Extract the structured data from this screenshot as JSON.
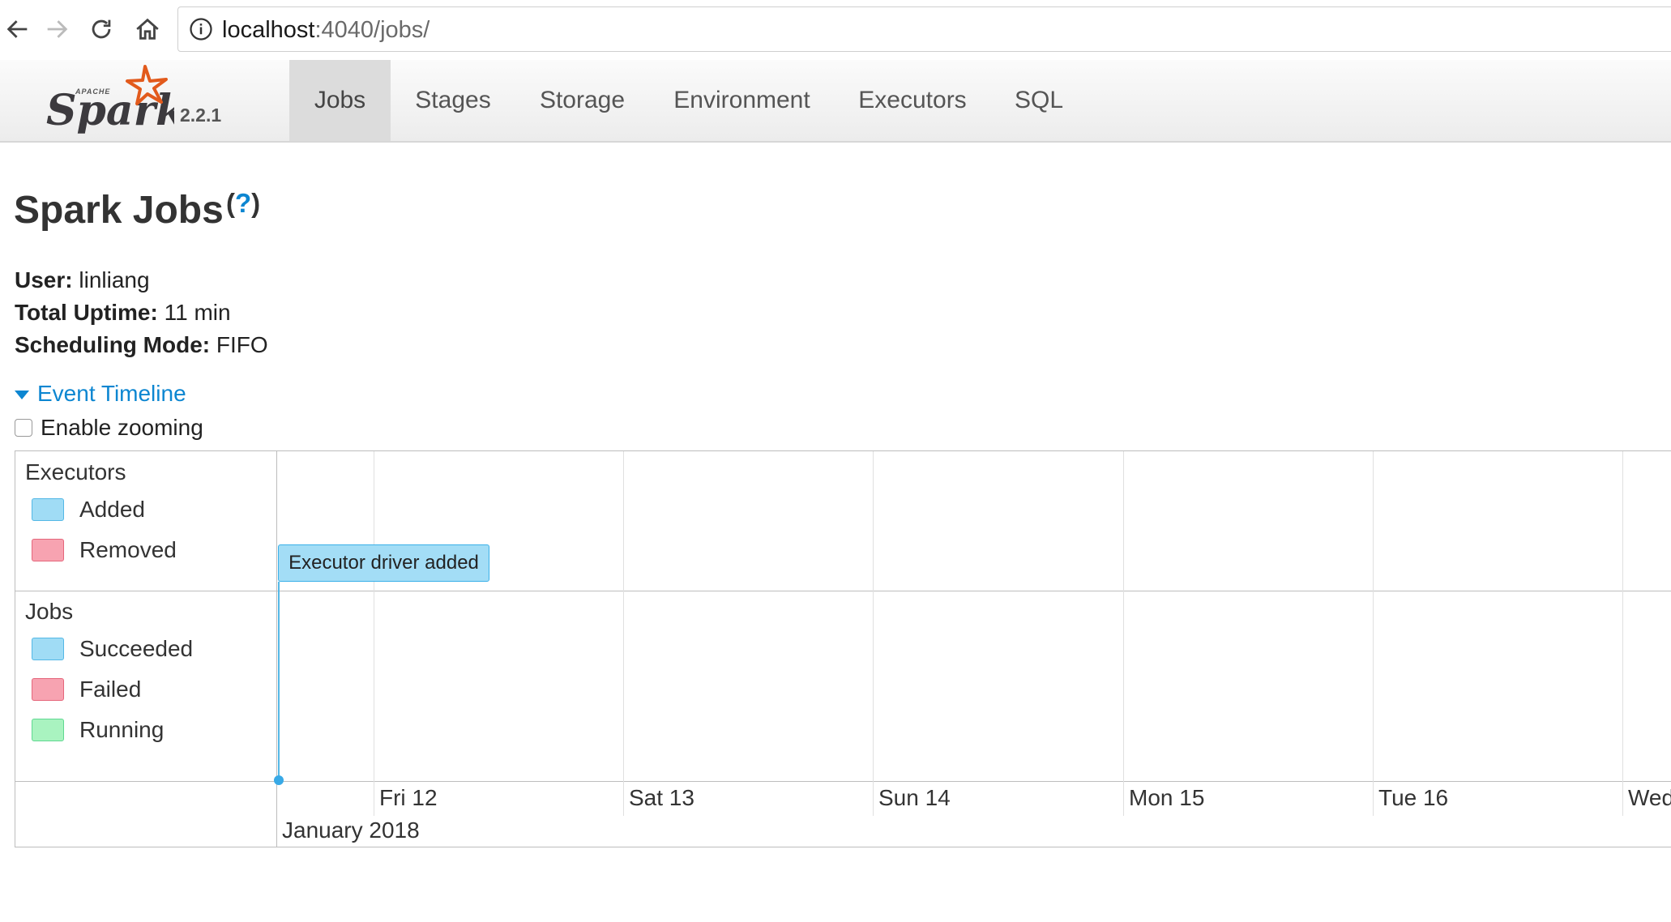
{
  "browser": {
    "url_host": "localhost",
    "url_rest": ":4040/jobs/"
  },
  "navbar": {
    "logo_text": "Spark",
    "logo_small_text": "APACHE",
    "version": "2.2.1",
    "tabs": [
      {
        "label": "Jobs",
        "active": true
      },
      {
        "label": "Stages",
        "active": false
      },
      {
        "label": "Storage",
        "active": false
      },
      {
        "label": "Environment",
        "active": false
      },
      {
        "label": "Executors",
        "active": false
      },
      {
        "label": "SQL",
        "active": false
      }
    ]
  },
  "page": {
    "title": "Spark Jobs",
    "help_open": "(",
    "help_q": "?",
    "help_close": ")",
    "summary": [
      {
        "label": "User:",
        "value": " linliang"
      },
      {
        "label": "Total Uptime:",
        "value": " 11 min"
      },
      {
        "label": "Scheduling Mode:",
        "value": " FIFO"
      }
    ],
    "timeline_toggle": "Event Timeline",
    "zoom_label": "Enable zooming",
    "zoom_checked": false
  },
  "timeline": {
    "executors": {
      "title": "Executors",
      "legend": [
        {
          "label": "Added",
          "color": "#a0dcf5"
        },
        {
          "label": "Removed",
          "color": "#f7a3b1"
        }
      ]
    },
    "jobs": {
      "title": "Jobs",
      "legend": [
        {
          "label": "Succeeded",
          "color": "#a0dcf5"
        },
        {
          "label": "Failed",
          "color": "#f7a3b1"
        },
        {
          "label": "Running",
          "color": "#a9f3c0"
        }
      ]
    },
    "event": "Executor driver added",
    "ticks": [
      "Fri 12",
      "Sat 13",
      "Sun 14",
      "Mon 15",
      "Tue 16",
      "Wed"
    ],
    "month_label": "January 2018"
  }
}
